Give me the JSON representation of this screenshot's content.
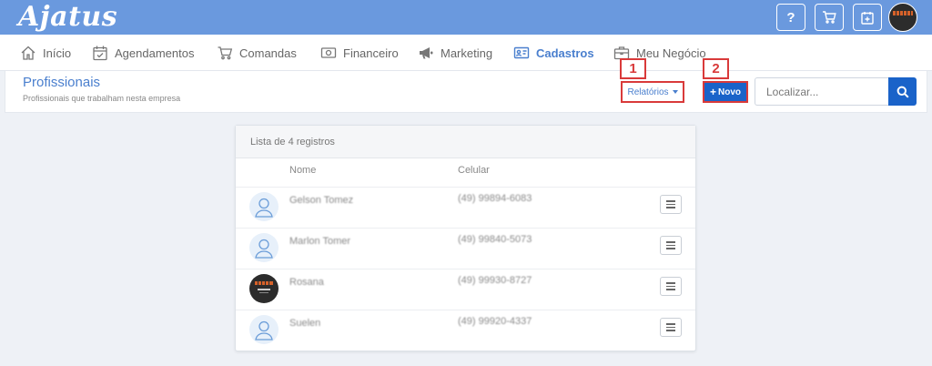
{
  "app": {
    "logo": "Ajatus"
  },
  "header": {
    "help_label": "?",
    "icons": [
      "help-icon",
      "cart-icon",
      "calendar-add-icon",
      "profile-avatar"
    ]
  },
  "nav": {
    "items": [
      {
        "label": "Início",
        "icon": "home-icon"
      },
      {
        "label": "Agendamentos",
        "icon": "calendar-check-icon"
      },
      {
        "label": "Comandas",
        "icon": "cart-icon"
      },
      {
        "label": "Financeiro",
        "icon": "money-icon"
      },
      {
        "label": "Marketing",
        "icon": "megaphone-icon"
      },
      {
        "label": "Cadastros",
        "icon": "id-card-icon",
        "active": true
      },
      {
        "label": "Meu Negócio",
        "icon": "briefcase-icon"
      }
    ]
  },
  "page": {
    "title": "Profissionais",
    "subtitle": "Profissionais que trabalham nesta empresa"
  },
  "toolbar": {
    "reports_label": "Relatórios",
    "new_label": "Novo",
    "search_placeholder": "Localizar..."
  },
  "callouts": [
    "1",
    "2"
  ],
  "list": {
    "header": "Lista de 4 registros",
    "columns": [
      "Nome",
      "Celular"
    ],
    "rows": [
      {
        "name": "Gelson Tomez",
        "phone": "(49) 99894-6083",
        "avatar": "default"
      },
      {
        "name": "Marlon Tomer",
        "phone": "(49) 99840-5073",
        "avatar": "default"
      },
      {
        "name": "Rosana",
        "phone": "(49) 99930-8727",
        "avatar": "logo"
      },
      {
        "name": "Suelen",
        "phone": "(49) 99920-4337",
        "avatar": "default"
      }
    ]
  },
  "colors": {
    "header_bg": "#6a99de",
    "accent": "#4a7fce",
    "primary_button": "#1a63c9",
    "annotation": "#d93a3a"
  }
}
